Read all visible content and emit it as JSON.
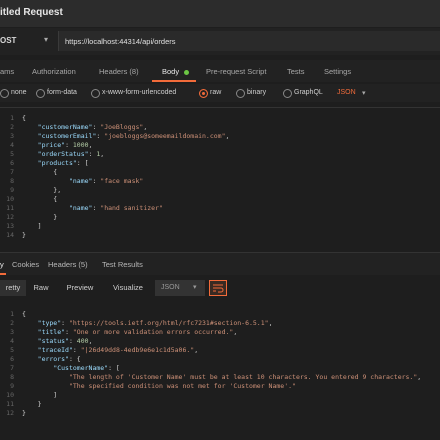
{
  "window": {
    "title": "itled Request"
  },
  "request": {
    "method": "OST",
    "url": "https://localhost:44314/api/orders",
    "tabs": [
      "ams",
      "Authorization",
      "Headers (8)",
      "Body",
      "Pre-request Script",
      "Tests",
      "Settings"
    ],
    "active_tab": "Body"
  },
  "body_options": {
    "items": [
      "none",
      "form-data",
      "x-www-form-urlencoded",
      "raw",
      "binary",
      "GraphQL"
    ],
    "selected": "raw",
    "format": "JSON"
  },
  "request_body": {
    "lines": [
      "{",
      "    \"customerName\": \"JoeBloggs\",",
      "    \"customerEmail\": \"joebloggs@someemaildomain.com\",",
      "    \"price\": 1000,",
      "    \"orderStatus\": 1,",
      "    \"products\": [",
      "        {",
      "            \"name\": \"face mask\"",
      "        },",
      "        {",
      "            \"name\": \"hand sanitizer\"",
      "        }",
      "    ]",
      "}"
    ],
    "line_numbers": [
      "1",
      "2",
      "3",
      "4",
      "5",
      "6",
      "7",
      "8",
      "9",
      "10",
      "11",
      "12",
      "13",
      "14"
    ]
  },
  "response_tabs": {
    "items": [
      "y",
      "Cookies",
      "Headers (5)",
      "Test Results"
    ],
    "headers_count": "(5)"
  },
  "response_toolbar": {
    "pretty": "retty",
    "raw": "Raw",
    "preview": "Preview",
    "visualize": "Visualize",
    "format": "JSON"
  },
  "response_body": {
    "lines": [
      "{",
      "    \"type\": \"https://tools.ietf.org/html/rfc7231#section-6.5.1\",",
      "    \"title\": \"One or more validation errors occurred.\",",
      "    \"status\": 400,",
      "    \"traceId\": \"|26d49dd8-4edb9e6e1c1d5a06.\",",
      "    \"errors\": {",
      "        \"CustomerName\": [",
      "            \"The length of 'Customer Name' must be at least 10 characters. You entered 9 characters.\",",
      "            \"The specified condition was not met for 'Customer Name'.\"",
      "        ]",
      "    }",
      "}"
    ],
    "line_numbers": [
      "1",
      "2",
      "3",
      "4",
      "5",
      "6",
      "7",
      "8",
      "9",
      "10",
      "11",
      "12"
    ]
  },
  "colors": {
    "accent": "#f26b3a",
    "key": "#9cdcfe",
    "string": "#ce9178",
    "number": "#b5cea8"
  }
}
